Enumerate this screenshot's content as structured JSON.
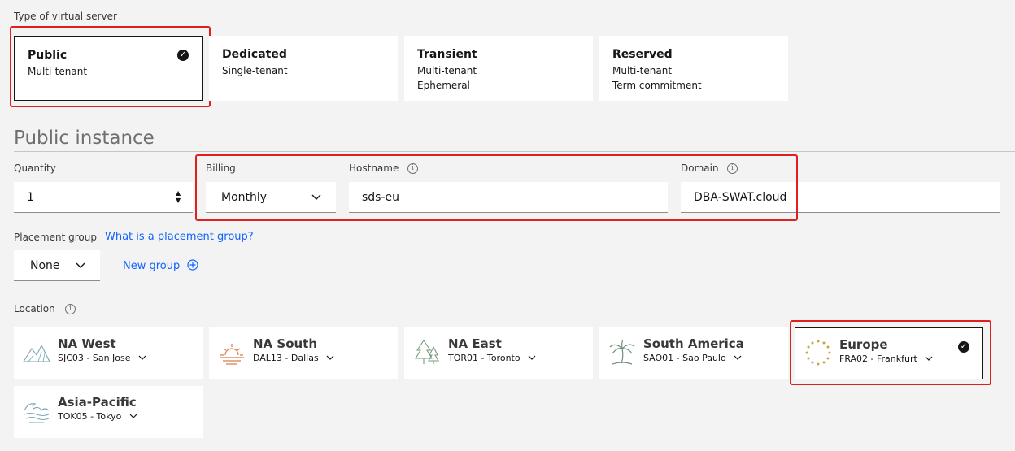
{
  "server_type": {
    "label": "Type of virtual server",
    "options": [
      {
        "title": "Public",
        "lines": [
          "Multi-tenant"
        ],
        "selected": true
      },
      {
        "title": "Dedicated",
        "lines": [
          "Single-tenant"
        ],
        "selected": false
      },
      {
        "title": "Transient",
        "lines": [
          "Multi-tenant",
          "Ephemeral"
        ],
        "selected": false
      },
      {
        "title": "Reserved",
        "lines": [
          "Multi-tenant",
          "Term commitment"
        ],
        "selected": false
      }
    ]
  },
  "section_title": "Public instance",
  "quantity": {
    "label": "Quantity",
    "value": "1"
  },
  "billing": {
    "label": "Billing",
    "value": "Monthly"
  },
  "hostname": {
    "label": "Hostname",
    "value": "sds-eu",
    "info_icon": "info-icon"
  },
  "domain": {
    "label": "Domain",
    "value": "DBA-SWAT.cloud",
    "info_icon": "info-icon"
  },
  "placement": {
    "label": "Placement group",
    "help_link": "What is a placement group?",
    "value": "None",
    "new_group": "New group"
  },
  "location": {
    "label": "Location",
    "options": [
      {
        "name": "NA West",
        "datacenter": "SJC03 - San Jose",
        "icon": "mountains-icon",
        "selected": false
      },
      {
        "name": "NA South",
        "datacenter": "DAL13 - Dallas",
        "icon": "sunset-icon",
        "selected": false
      },
      {
        "name": "NA East",
        "datacenter": "TOR01 - Toronto",
        "icon": "trees-icon",
        "selected": false
      },
      {
        "name": "South America",
        "datacenter": "SAO01 - Sao Paulo",
        "icon": "palm-tree-icon",
        "selected": false
      },
      {
        "name": "Europe",
        "datacenter": "FRA02 - Frankfurt",
        "icon": "stars-circle-icon",
        "selected": true
      },
      {
        "name": "Asia-Pacific",
        "datacenter": "TOK05 - Tokyo",
        "icon": "waves-icon",
        "selected": false
      }
    ]
  },
  "colors": {
    "highlight": "#e02020",
    "link": "#0f62fe",
    "icon_line": "#7aa7b3",
    "icon_sun": "#d97a4a",
    "icon_stars": "#c9a24a"
  }
}
